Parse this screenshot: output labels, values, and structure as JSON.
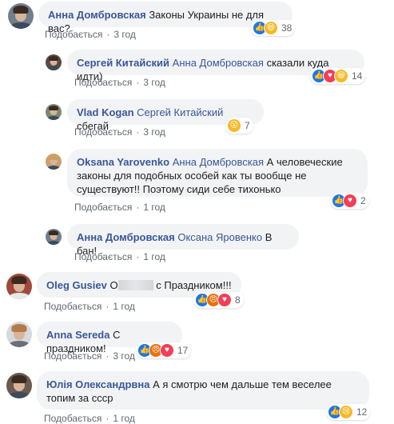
{
  "like_label": "Подобається",
  "comments": [
    {
      "author": "Анна Домбровская",
      "mention": "",
      "text": "Законы Украины не для вас?",
      "time": "3 год",
      "reactions": [
        "like",
        "haha"
      ],
      "count": "38"
    },
    {
      "author": "Сергей Китайский",
      "mention": "Анна Домбровская",
      "text": "сказали куда идти)",
      "time": "3 год",
      "reactions": [
        "like",
        "love",
        "haha"
      ],
      "count": "14"
    },
    {
      "author": "Vlad Kogan",
      "mention": "Сергей Китайский",
      "text": "сбегай",
      "time": "3 год",
      "reactions": [
        "wow"
      ],
      "count": "7"
    },
    {
      "author": "Oksana Yarovenko",
      "mention": "Анна Домбровская",
      "text": "А человеческие законы для подобных особей как ты вообще не существуют!! Поэтому сиди себе тихонько",
      "time": "1 год",
      "reactions": [
        "like",
        "love"
      ],
      "count": "2"
    },
    {
      "author": "Анна Домбровская",
      "mention": "Оксана Яровенко",
      "text": "В бан!",
      "time": "1 год",
      "reactions": [],
      "count": ""
    },
    {
      "author": "Oleg Gusiev",
      "mention": "",
      "text_prefix": "О",
      "text": "с Праздником!!!",
      "time": "1 год",
      "reactions": [
        "like",
        "angry",
        "love"
      ],
      "count": "8"
    },
    {
      "author": "Anna Sereda",
      "mention": "",
      "text": "С праздником!",
      "time": "3 год",
      "reactions": [
        "like",
        "angry",
        "love"
      ],
      "count": "17"
    },
    {
      "author": "Юлія Олександрвна",
      "mention": "",
      "text": "А я смотрю чем дальше тем веселее топим за ссср",
      "time": "1 год",
      "reactions": [
        "like",
        "sad"
      ],
      "count": "12"
    }
  ],
  "colors": {
    "link": "#385898",
    "bubble": "#f2f3f5",
    "meta": "#616770"
  },
  "icons": {
    "like": "thumbs-up-icon",
    "love": "heart-icon",
    "haha": "haha-icon",
    "wow": "wow-icon",
    "angry": "angry-icon",
    "sad": "sad-icon"
  }
}
